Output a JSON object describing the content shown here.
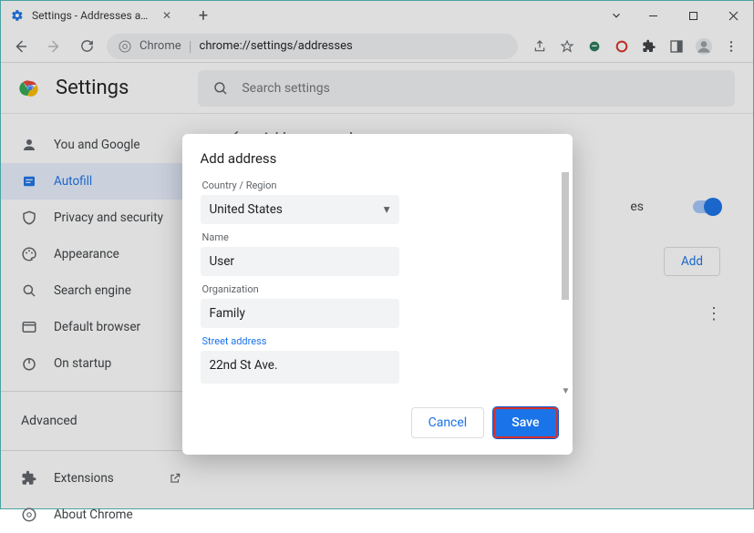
{
  "window": {
    "tab_title": "Settings - Addresses and more",
    "url_label": "Chrome",
    "url_path": "chrome://settings/addresses"
  },
  "settings": {
    "title": "Settings",
    "search_placeholder": "Search settings"
  },
  "sidebar": {
    "items": [
      {
        "label": "You and Google"
      },
      {
        "label": "Autofill"
      },
      {
        "label": "Privacy and security"
      },
      {
        "label": "Appearance"
      },
      {
        "label": "Search engine"
      },
      {
        "label": "Default browser"
      },
      {
        "label": "On startup"
      }
    ],
    "advanced_label": "Advanced",
    "extensions_label": "Extensions",
    "about_label": "About Chrome"
  },
  "content": {
    "breadcrumb": "Addresses and more",
    "partial_label": "es",
    "add_button": "Add"
  },
  "dialog": {
    "title": "Add address",
    "country_label": "Country / Region",
    "country_value": "United States",
    "name_label": "Name",
    "name_value": "User",
    "org_label": "Organization",
    "org_value": "Family",
    "street_label": "Street address",
    "street_value": "22nd St Ave.",
    "cancel": "Cancel",
    "save": "Save"
  }
}
